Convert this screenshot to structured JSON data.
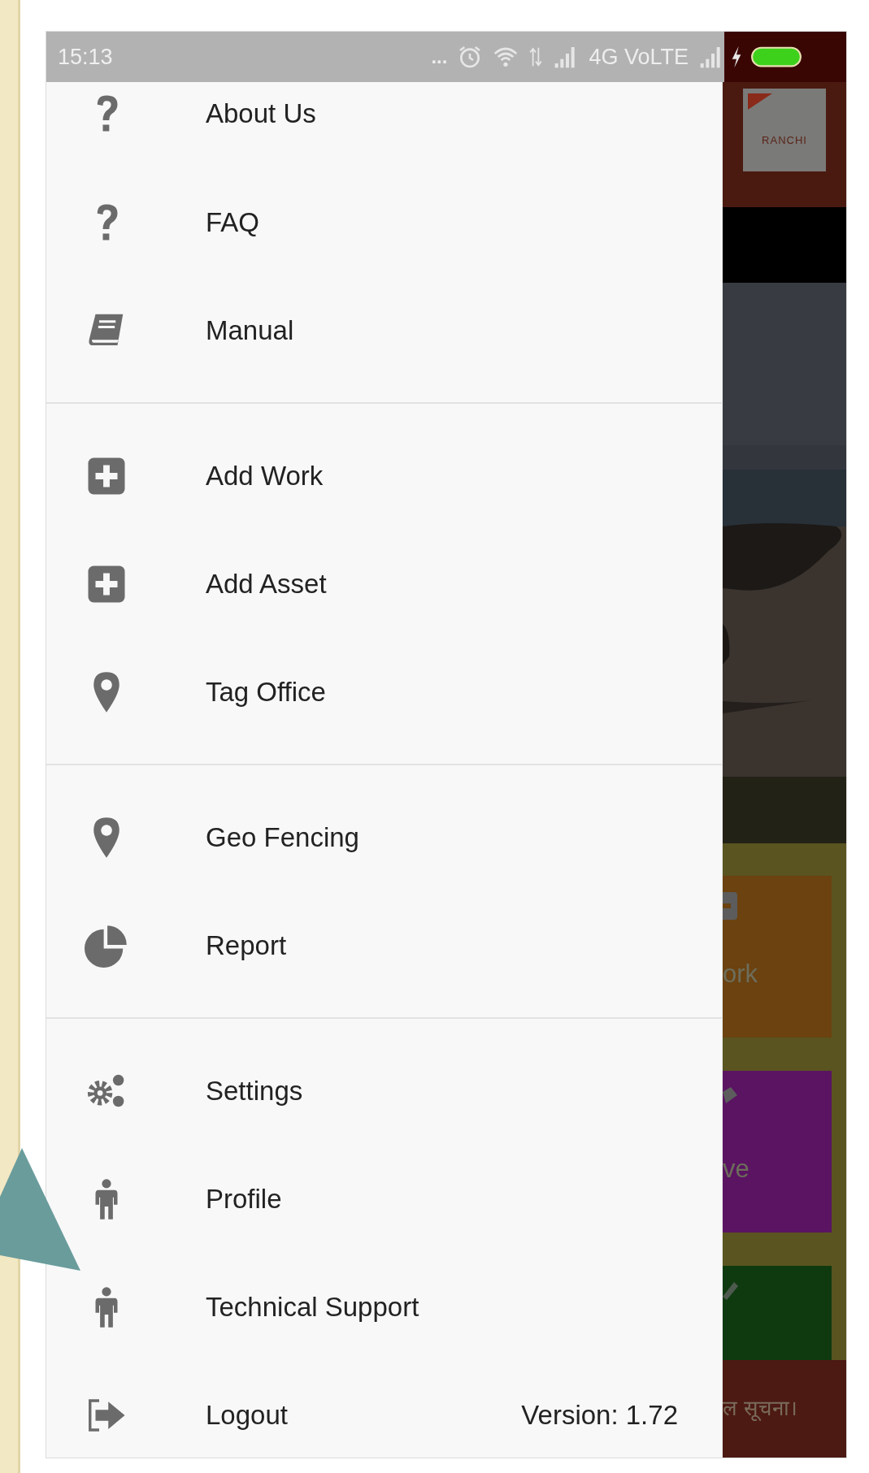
{
  "status_bar": {
    "time": "15:13",
    "more": "...",
    "network": "4G VoLTE"
  },
  "drawer": {
    "sections": [
      {
        "items": [
          {
            "label": "About Us"
          },
          {
            "label": "FAQ"
          },
          {
            "label": "Manual"
          }
        ]
      },
      {
        "items": [
          {
            "label": "Add Work"
          },
          {
            "label": "Add Asset"
          },
          {
            "label": "Tag Office"
          }
        ]
      },
      {
        "items": [
          {
            "label": "Geo Fencing"
          },
          {
            "label": "Report"
          }
        ]
      },
      {
        "items": [
          {
            "label": "Settings"
          },
          {
            "label": "Profile"
          },
          {
            "label": "Technical Support"
          },
          {
            "label": "Logout",
            "note": "Version: 1.72"
          }
        ]
      }
    ]
  },
  "background_app": {
    "logo_text": "RANCHI",
    "tiles": [
      {
        "label": "ork",
        "color": "#6b4210"
      },
      {
        "label": "ve",
        "color": "#5a1462"
      },
      {
        "color": "#0f3a10"
      }
    ],
    "ticker": "ल सूचना।"
  }
}
